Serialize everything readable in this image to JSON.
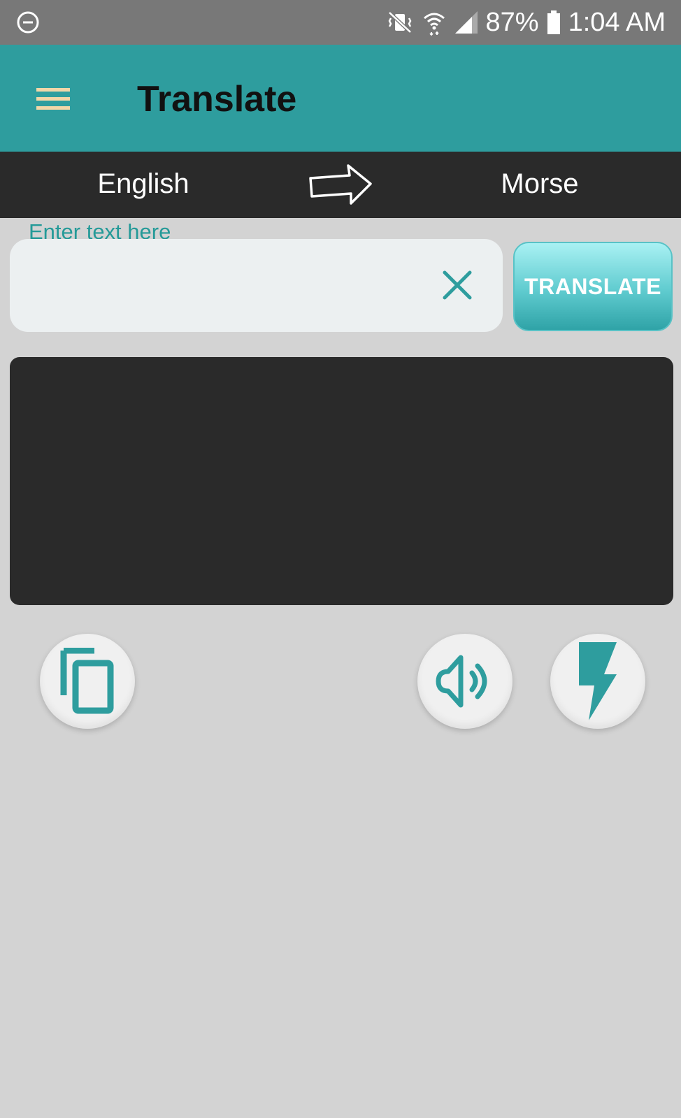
{
  "status_bar": {
    "battery": "87%",
    "time": "1:04 AM"
  },
  "app_bar": {
    "title": "Translate",
    "menu_icon": "hamburger-menu-icon"
  },
  "languages": {
    "from": "English",
    "to": "Morse",
    "swap_icon": "right-arrow-icon"
  },
  "input": {
    "label": "Enter text here",
    "value": "",
    "placeholder": "",
    "clear_icon": "close-icon"
  },
  "translate_button": {
    "label": "TRANSLATE"
  },
  "output": {
    "text": ""
  },
  "actions": [
    {
      "icon": "copy-icon"
    },
    {
      "icon": "speaker-icon"
    },
    {
      "icon": "flash-icon"
    }
  ],
  "colors": {
    "accent": "#2e9d9e",
    "dark": "#2a2a2a",
    "background": "#d3d3d3",
    "menu_icon": "#f2d7a8"
  }
}
